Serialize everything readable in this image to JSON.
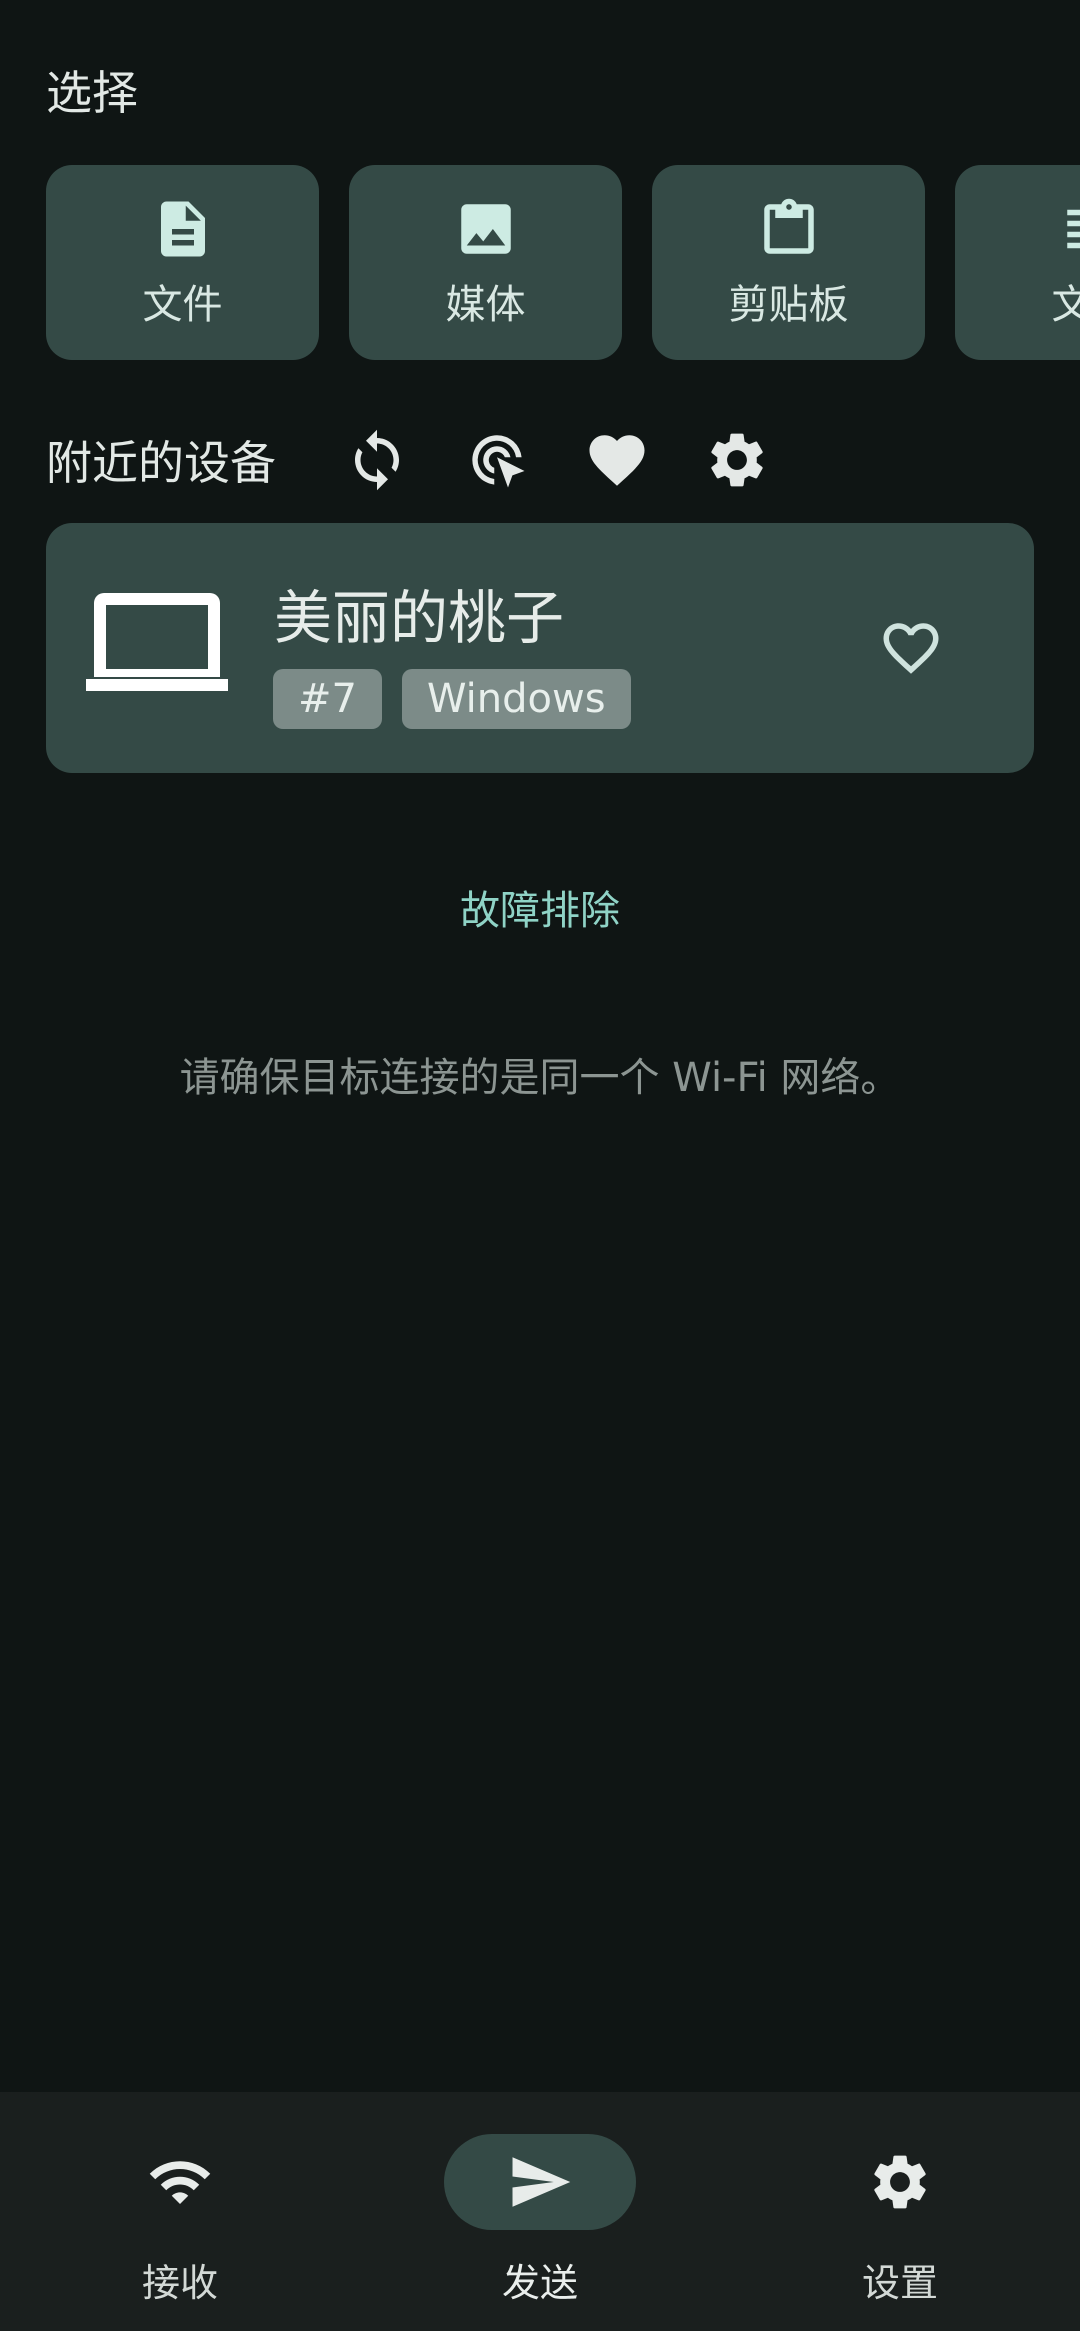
{
  "header": {
    "title": "选择"
  },
  "pick": [
    {
      "label": "文件",
      "icon": "file-icon"
    },
    {
      "label": "媒体",
      "icon": "image-icon"
    },
    {
      "label": "剪贴板",
      "icon": "clipboard-icon"
    },
    {
      "label": "文本",
      "icon": "text-icon"
    }
  ],
  "nearby": {
    "title": "附近的设备",
    "icons": [
      "refresh-icon",
      "scan-target-icon",
      "favorites-heart-icon",
      "settings-gear-icon"
    ]
  },
  "device": {
    "name": "美丽的桃子",
    "id_tag": "#7",
    "os_tag": "Windows",
    "icon": "laptop-icon"
  },
  "troubleshoot_label": "故障排除",
  "hint_text": "请确保目标连接的是同一个 Wi-Fi 网络。",
  "bottom_nav": [
    {
      "label": "接收",
      "icon": "wifi-icon",
      "active": false
    },
    {
      "label": "发送",
      "icon": "send-icon",
      "active": true
    },
    {
      "label": "设置",
      "icon": "gear-icon",
      "active": false
    }
  ],
  "colors": {
    "background": "#0f1514",
    "card": "#344a46",
    "accent": "#8fd3c6",
    "nav_bar": "#1a1f1e"
  }
}
